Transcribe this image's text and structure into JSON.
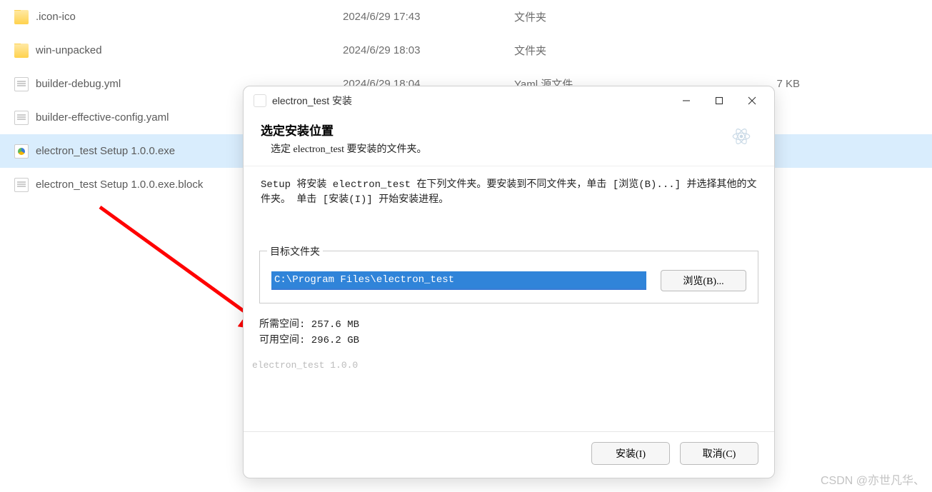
{
  "file_list": {
    "rows": [
      {
        "icon": "folder",
        "name": ".icon-ico",
        "date": "2024/6/29 17:43",
        "type": "文件夹",
        "size": ""
      },
      {
        "icon": "folder",
        "name": "win-unpacked",
        "date": "2024/6/29 18:03",
        "type": "文件夹",
        "size": ""
      },
      {
        "icon": "file",
        "name": "builder-debug.yml",
        "date": "2024/6/29 18:04",
        "type": "Yaml 源文件",
        "size": "7 KB"
      },
      {
        "icon": "file",
        "name": "builder-effective-config.yaml",
        "date": "",
        "type": "",
        "size": ""
      },
      {
        "icon": "exe",
        "name": "electron_test Setup 1.0.0.exe",
        "date": "",
        "type": "",
        "size": "",
        "selected": true
      },
      {
        "icon": "file",
        "name": "electron_test Setup 1.0.0.exe.block",
        "date": "",
        "type": "",
        "size": ""
      }
    ]
  },
  "dialog": {
    "window_title": "electron_test 安装",
    "header_title": "选定安装位置",
    "header_sub": "选定 electron_test 要安装的文件夹。",
    "desc_line1": "Setup 将安装 electron_test 在下列文件夹。要安装到不同文件夹，单击 [浏览(B)...] 并选择其他的文件夹。 单击 [安装(I)] 开始安装进程。",
    "target_legend": "目标文件夹",
    "path_value": "C:\\Program Files\\electron_test",
    "browse_label": "浏览(B)...",
    "space_required": "所需空间: 257.6 MB",
    "space_available": "可用空间: 296.2 GB",
    "brand": "electron_test 1.0.0",
    "install_label": "安装(I)",
    "cancel_label": "取消(C)"
  },
  "watermark": "CSDN @亦世凡华、"
}
